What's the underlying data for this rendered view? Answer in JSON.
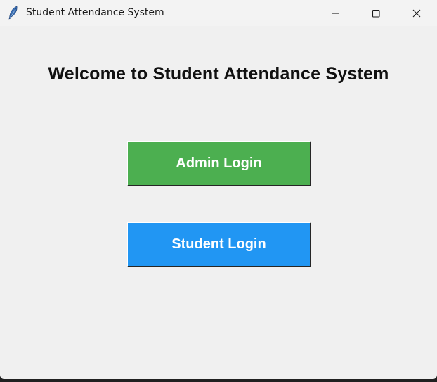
{
  "window": {
    "title": "Student Attendance System",
    "app_icon": "feather-icon",
    "controls": {
      "minimize_icon": "minimize-icon",
      "maximize_icon": "maximize-icon",
      "close_icon": "close-icon"
    }
  },
  "main": {
    "heading": "Welcome to Student Attendance System",
    "admin_login_label": "Admin Login",
    "student_login_label": "Student Login"
  },
  "colors": {
    "admin_button": "#4caf50",
    "student_button": "#2196f3",
    "background": "#f0f0f0",
    "titlebar": "#f3f3f3"
  }
}
